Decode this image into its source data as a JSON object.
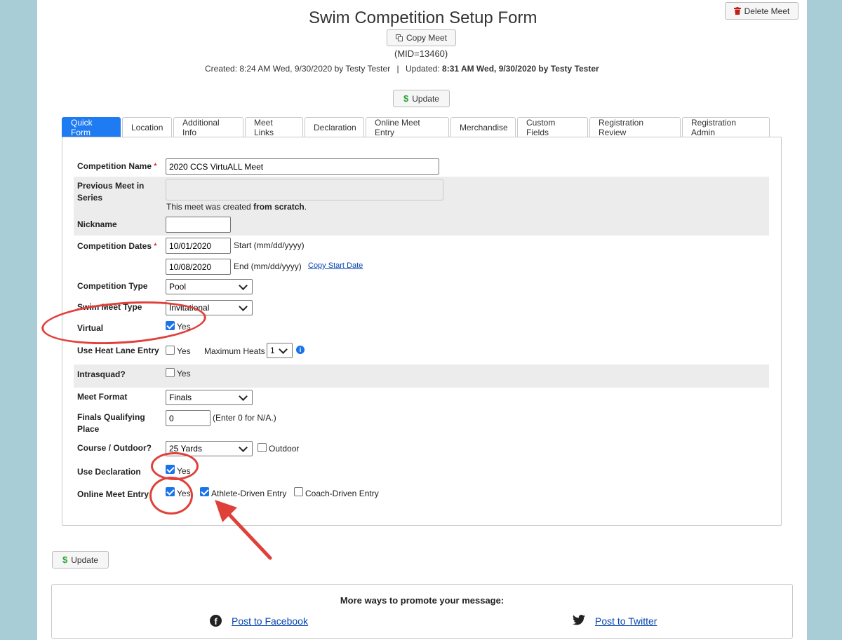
{
  "header": {
    "title": "Swim Competition Setup Form",
    "copy_meet_label": "Copy Meet",
    "delete_meet_label": "Delete Meet",
    "mid": "(MID=13460)",
    "created_text": "Created: 8:24 AM Wed, 9/30/2020 by Testy Tester",
    "separator": "|",
    "updated_label": "Updated:",
    "updated_value": "8:31 AM Wed, 9/30/2020 by Testy Tester",
    "update_label": "Update"
  },
  "tabs": [
    {
      "label": "Quick Form",
      "active": true
    },
    {
      "label": "Location"
    },
    {
      "label": "Additional Info"
    },
    {
      "label": "Meet Links"
    },
    {
      "label": "Declaration"
    },
    {
      "label": "Online Meet Entry"
    },
    {
      "label": "Merchandise"
    },
    {
      "label": "Custom Fields"
    },
    {
      "label": "Registration Review"
    },
    {
      "label": "Registration Admin"
    }
  ],
  "form": {
    "competition_name": {
      "label": "Competition Name",
      "required": "*",
      "value": "2020 CCS VirtuALL Meet"
    },
    "previous_meet": {
      "label": "Previous Meet in Series",
      "note_prefix": "This meet was created ",
      "note_bold": "from scratch",
      "note_suffix": "."
    },
    "nickname": {
      "label": "Nickname",
      "value": ""
    },
    "dates": {
      "label": "Competition Dates",
      "required": "*",
      "start_value": "10/01/2020",
      "start_hint": "Start (mm/dd/yyyy)",
      "end_value": "10/08/2020",
      "end_hint": "End (mm/dd/yyyy)",
      "copy_link": "Copy Start Date"
    },
    "competition_type": {
      "label": "Competition Type",
      "value": "Pool"
    },
    "swim_meet_type": {
      "label": "Swim Meet Type",
      "value": "Invitational"
    },
    "virtual": {
      "label": "Virtual",
      "option": "Yes",
      "checked": true
    },
    "heat_lane": {
      "label": "Use Heat Lane Entry",
      "option": "Yes",
      "checked": false,
      "max_heats_label": "Maximum Heats",
      "max_heats_value": "1"
    },
    "intrasquad": {
      "label": "Intrasquad?",
      "option": "Yes",
      "checked": false
    },
    "meet_format": {
      "label": "Meet Format",
      "value": "Finals"
    },
    "finals_qualifying": {
      "label": "Finals Qualifying Place",
      "value": "0",
      "hint": "(Enter 0 for N/A.)"
    },
    "course": {
      "label": "Course / Outdoor?",
      "value": "25 Yards",
      "outdoor_label": "Outdoor",
      "outdoor_checked": false
    },
    "use_declaration": {
      "label": "Use Declaration",
      "option": "Yes",
      "checked": true
    },
    "online_meet_entry": {
      "label": "Online Meet Entry",
      "option": "Yes",
      "checked": true,
      "athlete_label": "Athlete-Driven Entry",
      "athlete_checked": true,
      "coach_label": "Coach-Driven Entry",
      "coach_checked": false
    }
  },
  "footer": {
    "update_label": "Update",
    "promo_title": "More ways to promote your message:",
    "facebook_label": "Post to Facebook",
    "twitter_label": "Post to Twitter"
  },
  "colors": {
    "accent": "#1f7bf2",
    "annotation": "#e0403a",
    "background": "#a9cdd6"
  }
}
